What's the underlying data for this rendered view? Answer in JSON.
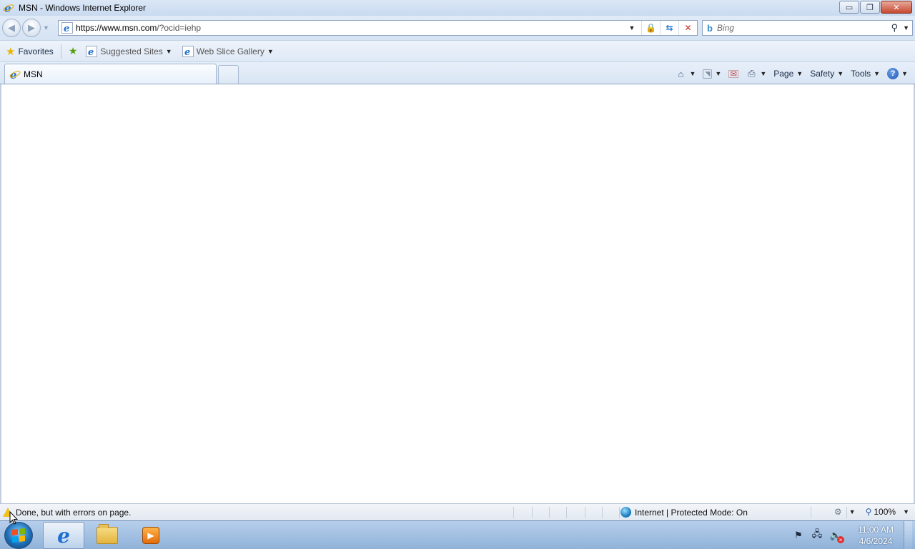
{
  "window": {
    "title": "MSN - Windows Internet Explorer",
    "minimize_glyph": "▭",
    "restore_glyph": "❐",
    "close_glyph": "✕"
  },
  "navigation": {
    "back_icon": "back-arrow-icon",
    "forward_icon": "forward-arrow-icon",
    "address": {
      "url_scheme_host": "https://www.msn.com",
      "url_rest": "/?ocid=iehp"
    },
    "search": {
      "placeholder": "Bing"
    }
  },
  "favorites_bar": {
    "favorites_label": "Favorites",
    "items": [
      {
        "label": "Suggested Sites"
      },
      {
        "label": "Web Slice Gallery"
      }
    ]
  },
  "tabs": {
    "active": {
      "label": "MSN"
    }
  },
  "command_bar": {
    "page_label": "Page",
    "safety_label": "Safety",
    "tools_label": "Tools"
  },
  "status_bar": {
    "message": "Done, but with errors on page.",
    "zone": "Internet | Protected Mode: On",
    "zoom": "100%"
  },
  "taskbar": {
    "time": "11:00 AM",
    "date": "4/6/2024"
  },
  "colors": {
    "accent": "#1d6fd1",
    "chrome": "#dfe9f5",
    "close_button": "#c6492f"
  }
}
